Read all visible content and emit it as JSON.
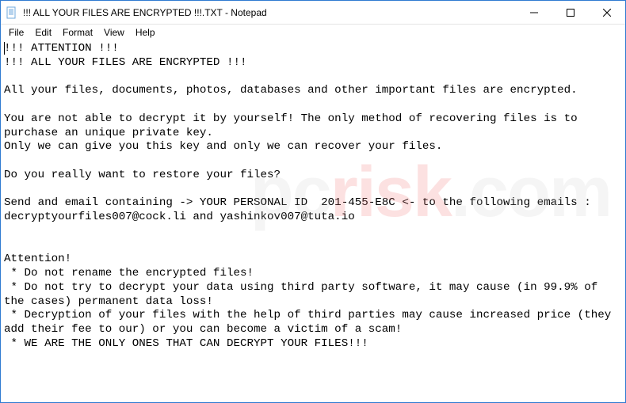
{
  "window": {
    "title": "!!! ALL YOUR FILES ARE ENCRYPTED !!!.TXT - Notepad"
  },
  "menu": {
    "file": "File",
    "edit": "Edit",
    "format": "Format",
    "view": "View",
    "help": "Help"
  },
  "document": {
    "body": "!!! ATTENTION !!!\n!!! ALL YOUR FILES ARE ENCRYPTED !!!\n\nAll your files, documents, photos, databases and other important files are encrypted.\n\nYou are not able to decrypt it by yourself! The only method of recovering files is to purchase an unique private key.\nOnly we can give you this key and only we can recover your files.\n\nDo you really want to restore your files?\n\nSend and email containing -> YOUR PERSONAL ID  201-455-E8C <- to the following emails : decryptyourfiles007@cock.li and yashinkov007@tuta.io\n\n\nAttention!\n * Do not rename the encrypted files!\n * Do not try to decrypt your data using third party software, it may cause (in 99.9% of the cases) permanent data loss!\n * Decryption of your files with the help of third parties may cause increased price (they add their fee to our) or you can become a victim of a scam!\n * WE ARE THE ONLY ONES THAT CAN DECRYPT YOUR FILES!!!"
  },
  "watermark": {
    "text_prefix": "pc",
    "text_red": "risk",
    "text_suffix": ".com"
  }
}
